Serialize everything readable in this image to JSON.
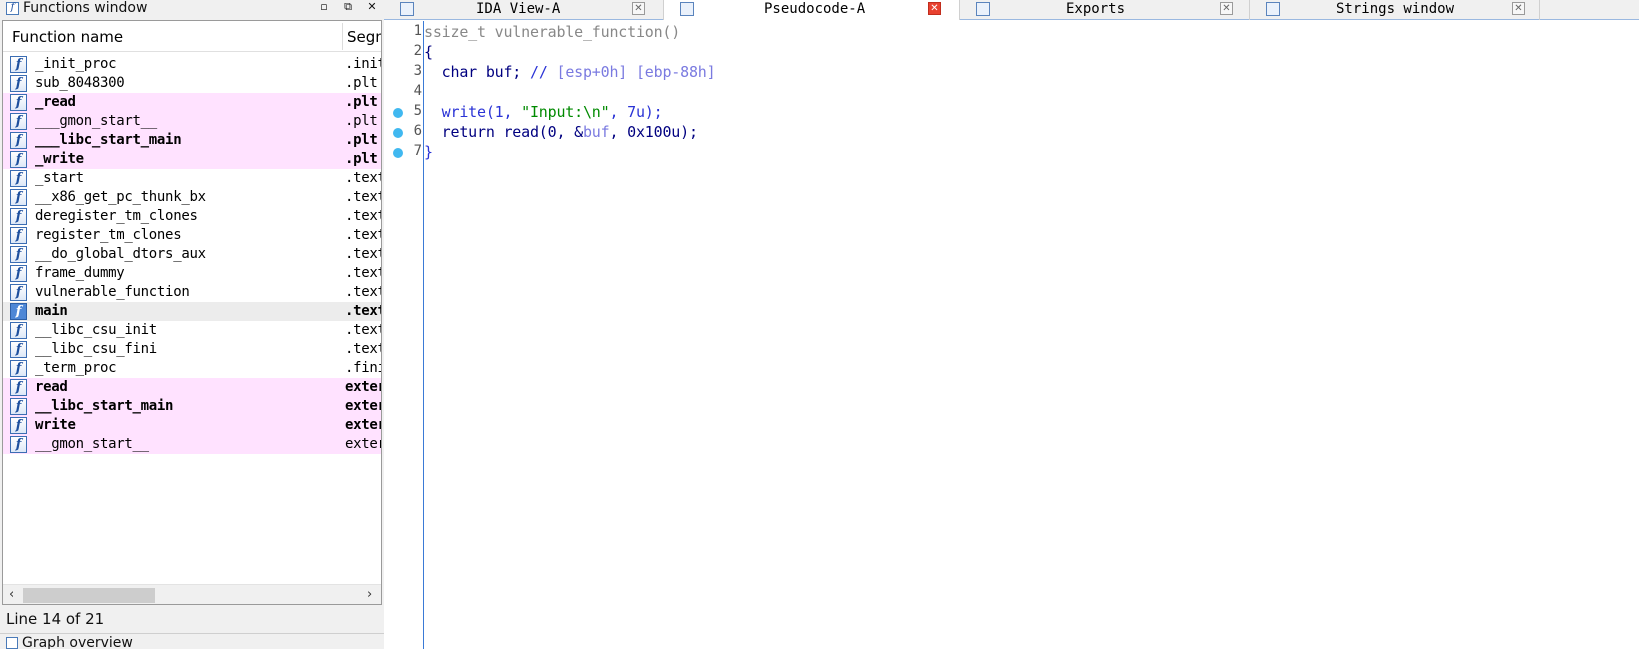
{
  "functions_window": {
    "title": "Functions window",
    "column_name": "Function name",
    "column_segment": "Segm",
    "rows": [
      {
        "name": "_init_proc",
        "segment": ".init",
        "style": "normal"
      },
      {
        "name": "sub_8048300",
        "segment": ".plt",
        "style": "normal"
      },
      {
        "name": "_read",
        "segment": ".plt",
        "style": "bold-pink"
      },
      {
        "name": "___gmon_start__",
        "segment": ".plt",
        "style": "pink"
      },
      {
        "name": "___libc_start_main",
        "segment": ".plt",
        "style": "bold-pink"
      },
      {
        "name": "_write",
        "segment": ".plt",
        "style": "bold-pink"
      },
      {
        "name": "_start",
        "segment": ".text",
        "style": "normal"
      },
      {
        "name": "__x86_get_pc_thunk_bx",
        "segment": ".text",
        "style": "normal"
      },
      {
        "name": "deregister_tm_clones",
        "segment": ".text",
        "style": "normal"
      },
      {
        "name": "register_tm_clones",
        "segment": ".text",
        "style": "normal"
      },
      {
        "name": "__do_global_dtors_aux",
        "segment": ".text",
        "style": "normal"
      },
      {
        "name": "frame_dummy",
        "segment": ".text",
        "style": "normal"
      },
      {
        "name": "vulnerable_function",
        "segment": ".text",
        "style": "normal"
      },
      {
        "name": "main",
        "segment": ".text",
        "style": "bold-selected"
      },
      {
        "name": "__libc_csu_init",
        "segment": ".text",
        "style": "normal"
      },
      {
        "name": "__libc_csu_fini",
        "segment": ".text",
        "style": "normal"
      },
      {
        "name": "_term_proc",
        "segment": ".fini",
        "style": "normal"
      },
      {
        "name": "read",
        "segment": "extern",
        "style": "bold-pink"
      },
      {
        "name": "__libc_start_main",
        "segment": "extern",
        "style": "bold-pink"
      },
      {
        "name": "write",
        "segment": "extern",
        "style": "bold-pink"
      },
      {
        "name": "__gmon_start__",
        "segment": "extern",
        "style": "pink"
      }
    ],
    "function_icon_glyph": "f",
    "status": "Line 14 of 21"
  },
  "graph_overview": {
    "title": "Graph overview"
  },
  "window_buttons": {
    "restore": "▫",
    "float": "⧉",
    "close": "✕"
  },
  "tabs": [
    {
      "label": "IDA View-A",
      "active": false
    },
    {
      "label": "Pseudocode-A",
      "active": true
    },
    {
      "label": "Exports",
      "active": false
    },
    {
      "label": "Strings window",
      "active": false
    }
  ],
  "tab_close_glyph": "✕",
  "pseudocode": {
    "lines": [
      {
        "num": "1",
        "breakpoint": false,
        "tokens": [
          {
            "t": "ssize_t vulnerable_function()",
            "c": "gray"
          }
        ]
      },
      {
        "num": "2",
        "breakpoint": false,
        "tokens": [
          {
            "t": "{",
            "c": "navy"
          }
        ]
      },
      {
        "num": "3",
        "breakpoint": false,
        "tokens": [
          {
            "t": "  char buf; ",
            "c": "navy"
          },
          {
            "t": "// ",
            "c": "blue"
          },
          {
            "t": "[esp+0h] [ebp-88h]",
            "c": "cmt"
          }
        ]
      },
      {
        "num": "4",
        "breakpoint": false,
        "tokens": []
      },
      {
        "num": "5",
        "breakpoint": true,
        "tokens": [
          {
            "t": "  write(1, ",
            "c": "blue"
          },
          {
            "t": "\"Input:\\n\"",
            "c": "green"
          },
          {
            "t": ", 7u);",
            "c": "blue"
          }
        ]
      },
      {
        "num": "6",
        "breakpoint": true,
        "tokens": [
          {
            "t": "  return read(0, &",
            "c": "navy"
          },
          {
            "t": "buf",
            "c": "cmt"
          },
          {
            "t": ", 0x100u);",
            "c": "navy"
          }
        ]
      },
      {
        "num": "7",
        "breakpoint": true,
        "tokens": [
          {
            "t": "}",
            "c": "blue"
          }
        ]
      }
    ]
  },
  "scroll_arrows": {
    "left": "‹",
    "right": "›"
  },
  "colors": {
    "pink_row": "#ffe2ff",
    "selected_row": "#ececec",
    "breakpoint": "#40b8f0",
    "gutter_line": "#3a7ad6",
    "close_active": "#e8412f"
  }
}
